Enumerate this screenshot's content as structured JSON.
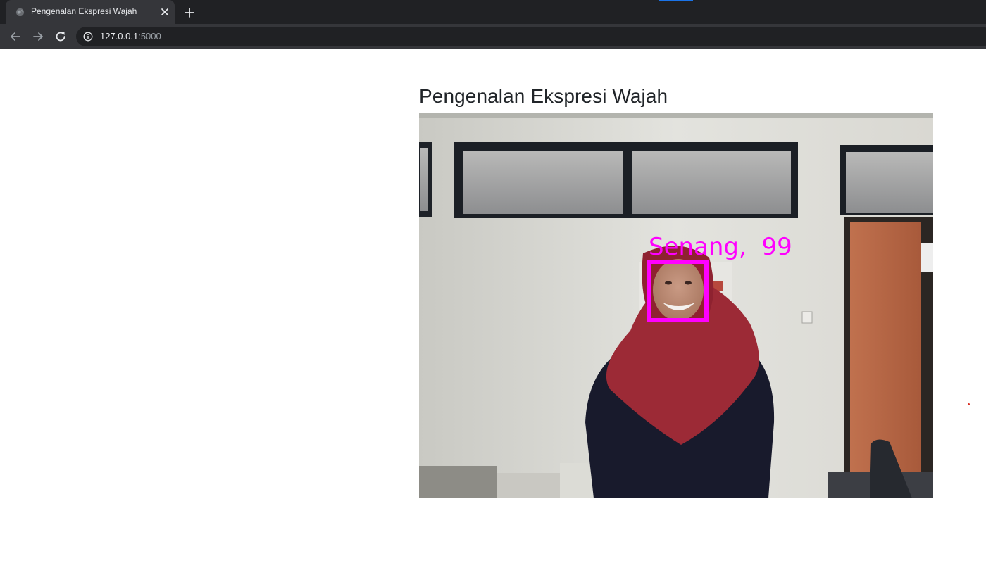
{
  "browser": {
    "tab_title": "Pengenalan Ekspresi Wajah",
    "url_host": "127.0.0.1",
    "url_port": ":5000"
  },
  "page": {
    "heading": "Pengenalan Ekspresi Wajah"
  },
  "video_feed": {
    "detection": {
      "label": "Senang,  99",
      "box_color": "#ff00ff"
    }
  }
}
